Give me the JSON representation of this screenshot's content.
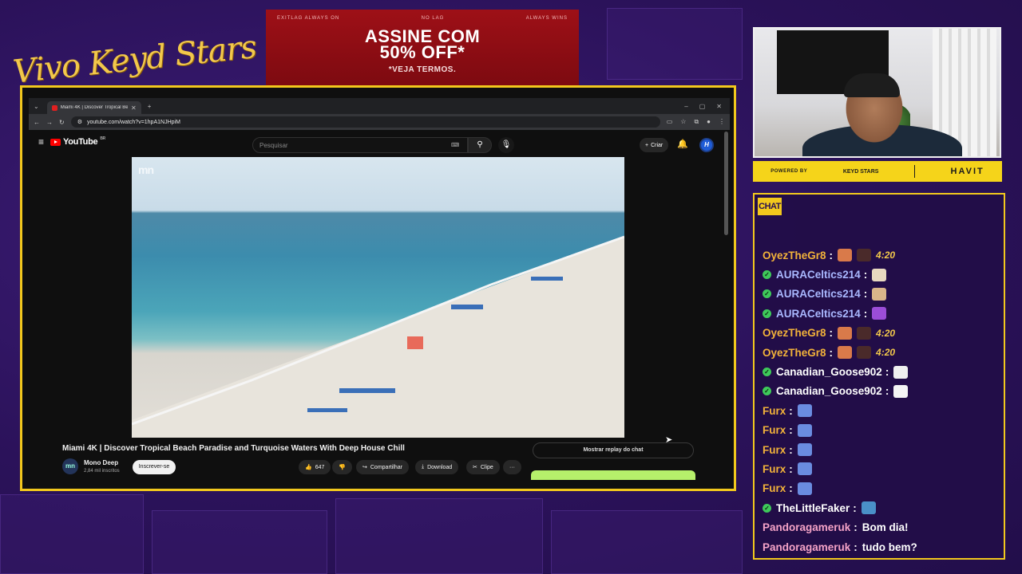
{
  "overlay": {
    "stream_title": "Vivo Keyd Stars",
    "ad": {
      "top_left": "EXITLAG ALWAYS ON",
      "top_center": "NO LAG",
      "top_right": "ALWAYS WINS",
      "line1": "ASSINE COM",
      "line2": "50% OFF*",
      "line3": "*VEJA TERMOS."
    },
    "sponsor": {
      "powered_by": "POWERED BY",
      "keyd": "KEYD STARS",
      "havit": "HAVIT"
    },
    "chat_header": "CHAT"
  },
  "browser": {
    "tab_title": "Miami 4K | Discover Tropical Be",
    "url": "youtube.com/watch?v=1hpA1NJHpiM"
  },
  "youtube": {
    "logo_text": "YouTube",
    "country": "BR",
    "search_placeholder": "Pesquisar",
    "create_label": "Criar",
    "avatar_letter": "H",
    "video_watermark": "mn",
    "video_title": "Miami 4K | Discover Tropical Beach Paradise and Turquoise Waters With Deep House Chill",
    "channel": {
      "avatar_text": "mn",
      "name": "Mono Deep",
      "subscribers": "2,84 mil inscritos",
      "subscribe_label": "Inscrever-se"
    },
    "actions": {
      "likes": "647",
      "share": "Compartilhar",
      "download": "Download",
      "clip": "Clipe",
      "more": "···"
    },
    "chat_replay": "Mostrar replay do chat"
  },
  "chat": [
    {
      "user": "OyezTheGr8",
      "color": "#f2b23a",
      "mod": false,
      "emotes": [
        "#d97a4a",
        "#4a2a2a"
      ],
      "emote_text": "4:20",
      "text": ""
    },
    {
      "user": "AURACeltics214",
      "color": "#a9b8ff",
      "mod": true,
      "emotes": [
        "#e8d9c0"
      ],
      "emote_text": "",
      "text": ""
    },
    {
      "user": "AURACeltics214",
      "color": "#a9b8ff",
      "mod": true,
      "emotes": [
        "#d9b58a"
      ],
      "emote_text": "",
      "text": ""
    },
    {
      "user": "AURACeltics214",
      "color": "#a9b8ff",
      "mod": true,
      "emotes": [
        "#9b4dd8"
      ],
      "emote_text": "",
      "text": ""
    },
    {
      "user": "OyezTheGr8",
      "color": "#f2b23a",
      "mod": false,
      "emotes": [
        "#d97a4a",
        "#4a2a2a"
      ],
      "emote_text": "4:20",
      "text": ""
    },
    {
      "user": "OyezTheGr8",
      "color": "#f2b23a",
      "mod": false,
      "emotes": [
        "#d97a4a",
        "#4a2a2a"
      ],
      "emote_text": "4:20",
      "text": ""
    },
    {
      "user": "Canadian_Goose902",
      "color": "#ffffff",
      "mod": true,
      "emotes": [
        "#f0f0f0"
      ],
      "emote_text": "",
      "text": ""
    },
    {
      "user": "Canadian_Goose902",
      "color": "#ffffff",
      "mod": true,
      "emotes": [
        "#f5f5f5"
      ],
      "emote_text": "",
      "text": ""
    },
    {
      "user": "Furx",
      "color": "#f2b23a",
      "mod": false,
      "emotes": [
        "#6a8ce0"
      ],
      "emote_text": "",
      "text": ""
    },
    {
      "user": "Furx",
      "color": "#f2b23a",
      "mod": false,
      "emotes": [
        "#6a8ce0"
      ],
      "emote_text": "",
      "text": ""
    },
    {
      "user": "Furx",
      "color": "#f2b23a",
      "mod": false,
      "emotes": [
        "#6a8ce0"
      ],
      "emote_text": "",
      "text": ""
    },
    {
      "user": "Furx",
      "color": "#f2b23a",
      "mod": false,
      "emotes": [
        "#6a8ce0"
      ],
      "emote_text": "",
      "text": ""
    },
    {
      "user": "Furx",
      "color": "#f2b23a",
      "mod": false,
      "emotes": [
        "#6a8ce0"
      ],
      "emote_text": "",
      "text": ""
    },
    {
      "user": "TheLittleFaker",
      "color": "#ffffff",
      "mod": true,
      "emotes": [
        "#4a90c8"
      ],
      "emote_text": "",
      "text": ""
    },
    {
      "user": "Pandoragameruk",
      "color": "#f5a3c7",
      "mod": false,
      "emotes": [],
      "emote_text": "",
      "text": "Bom dia!"
    },
    {
      "user": "Pandoragameruk",
      "color": "#f5a3c7",
      "mod": false,
      "emotes": [],
      "emote_text": "",
      "text": "tudo bem?"
    }
  ]
}
